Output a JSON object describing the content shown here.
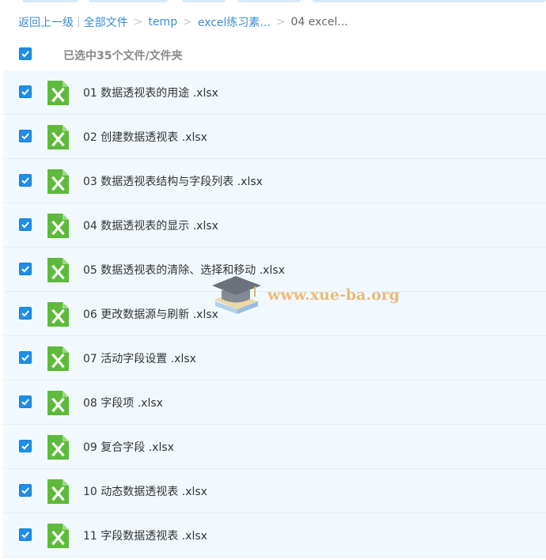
{
  "breadcrumb": {
    "back": "返回上一级",
    "items": [
      "全部文件",
      "temp",
      "excel练习素...",
      "04 excel..."
    ]
  },
  "selection": {
    "text": "已选中35个文件/文件夹"
  },
  "files": [
    "01 数据透视表的用途 .xlsx",
    "02 创建数据透视表 .xlsx",
    "03 数据透视表结构与字段列表 .xlsx",
    "04 数据透视表的显示 .xlsx",
    "05 数据透视表的清除、选择和移动 .xlsx",
    "06 更改数据源与刷新 .xlsx",
    "07 活动字段设置 .xlsx",
    "08 字段项 .xlsx",
    "09 复合字段 .xlsx",
    "10 动态数据透视表 .xlsx",
    "11 字段数据透视表 .xlsx"
  ],
  "icons": {
    "file": "excel-file-icon",
    "check": "checkbox-checked-icon"
  },
  "colors": {
    "link": "#3b8cd4",
    "checkbox": "#1e8ee8",
    "excel": "#5dba3a",
    "row_bg": "#f2f9fe"
  },
  "watermark": {
    "text": "www.xue-ba.org"
  }
}
